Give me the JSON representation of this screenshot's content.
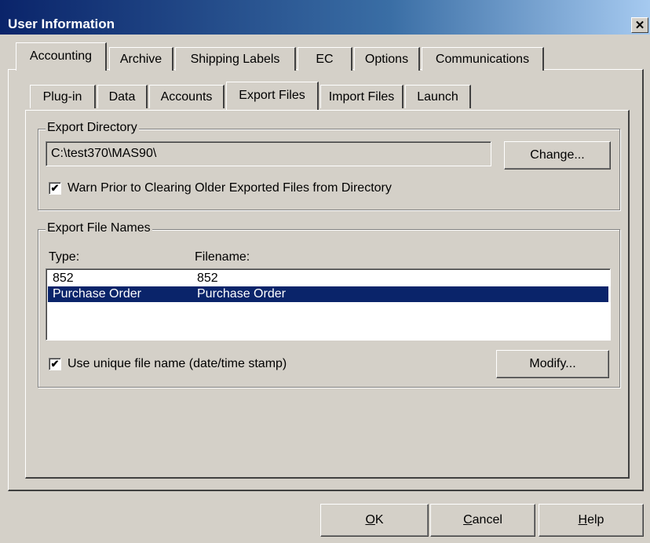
{
  "window": {
    "title": "User Information",
    "close_glyph": "✕"
  },
  "top_tabs": [
    "Accounting",
    "Archive",
    "Shipping Labels",
    "EC",
    "Options",
    "Communications"
  ],
  "sub_tabs": [
    "Plug-in",
    "Data",
    "Accounts",
    "Export Files",
    "Import Files",
    "Launch"
  ],
  "export_directory": {
    "legend": "Export Directory",
    "path": "C:\\test370\\MAS90\\",
    "change_label": "Change...",
    "warn_label": "Warn Prior to Clearing Older Exported Files from Directory",
    "warn_checked": true
  },
  "export_file_names": {
    "legend": "Export File Names",
    "col_type": "Type:",
    "col_filename": "Filename:",
    "rows": [
      {
        "type": "852",
        "filename": "852",
        "selected": false
      },
      {
        "type": "Purchase Order",
        "filename": "Purchase Order",
        "selected": true
      }
    ],
    "unique_label": "Use unique file name (date/time stamp)",
    "unique_checked": true,
    "modify_label": "Modify..."
  },
  "buttons": {
    "ok": {
      "accel": "O",
      "rest": "K"
    },
    "cancel": {
      "accel": "C",
      "rest": "ancel"
    },
    "help": {
      "accel": "H",
      "rest": "elp"
    }
  },
  "colors": {
    "selection": "#0a246a",
    "face": "#d4d0c8",
    "title_start": "#0a246a"
  },
  "icons": {
    "check": "✔"
  }
}
